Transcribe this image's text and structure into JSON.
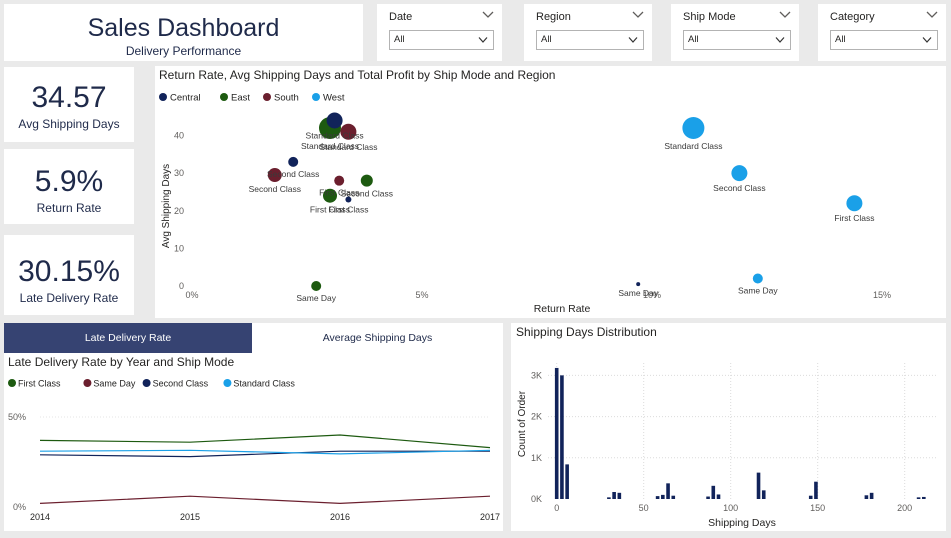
{
  "header": {
    "title": "Sales Dashboard",
    "subtitle": "Delivery Performance"
  },
  "slicers": [
    {
      "label": "Date",
      "value": "All"
    },
    {
      "label": "Region",
      "value": "All"
    },
    {
      "label": "Ship Mode",
      "value": "All"
    },
    {
      "label": "Category",
      "value": "All"
    }
  ],
  "kpis": [
    {
      "value": "34.57",
      "label": "Avg Shipping Days"
    },
    {
      "value": "5.9%",
      "label": "Return Rate"
    },
    {
      "value": "30.15%",
      "label": "Late Delivery Rate"
    }
  ],
  "tabs": {
    "late": "Late Delivery Rate",
    "avg": "Average Shipping Days"
  },
  "colors": {
    "Central": "#11235a",
    "East": "#1d5a10",
    "South": "#6b1f2e",
    "West": "#1aa0e8",
    "accent": "#364372"
  },
  "chart_data": [
    {
      "type": "scatter",
      "title": "Return Rate, Avg Shipping Days and Total Profit by Ship Mode and Region",
      "xlabel": "Return Rate",
      "ylabel": "Avg Shipping Days",
      "xlim": [
        0,
        15.5
      ],
      "ylim": [
        0,
        42
      ],
      "xticks": [
        "0%",
        "5%",
        "10%",
        "15%"
      ],
      "xtick_values": [
        0,
        5,
        10,
        15
      ],
      "yticks": [
        "0",
        "10",
        "20",
        "30",
        "40"
      ],
      "ytick_values": [
        0,
        10,
        20,
        30,
        40
      ],
      "legend_position": "top-left",
      "series": [
        {
          "name": "Central",
          "points": [
            {
              "x": 3.1,
              "y": 44,
              "size": 8,
              "label": "Standard Class"
            },
            {
              "x": 2.2,
              "y": 33,
              "size": 5,
              "label": "Second Class"
            },
            {
              "x": 3.4,
              "y": 23,
              "size": 3,
              "label": "First Class"
            },
            {
              "x": 9.7,
              "y": 0.5,
              "size": 2,
              "label": "Same Day"
            }
          ]
        },
        {
          "name": "East",
          "points": [
            {
              "x": 3.0,
              "y": 42,
              "size": 11,
              "label": "Standard Class"
            },
            {
              "x": 3.0,
              "y": 24,
              "size": 7,
              "label": "First Class"
            },
            {
              "x": 3.8,
              "y": 28,
              "size": 6,
              "label": "Second Class"
            },
            {
              "x": 2.7,
              "y": 0,
              "size": 5,
              "label": "Same Day"
            }
          ]
        },
        {
          "name": "South",
          "points": [
            {
              "x": 3.4,
              "y": 41,
              "size": 8,
              "label": "Standard Class"
            },
            {
              "x": 1.8,
              "y": 29.5,
              "size": 7,
              "label": "Second Class"
            },
            {
              "x": 3.2,
              "y": 28,
              "size": 5,
              "label": "First Class"
            }
          ]
        },
        {
          "name": "West",
          "points": [
            {
              "x": 10.9,
              "y": 42,
              "size": 11,
              "label": "Standard Class"
            },
            {
              "x": 11.9,
              "y": 30,
              "size": 8,
              "label": "Second Class"
            },
            {
              "x": 14.4,
              "y": 22,
              "size": 8,
              "label": "First Class"
            },
            {
              "x": 12.3,
              "y": 2,
              "size": 5,
              "label": "Same Day"
            }
          ]
        }
      ]
    },
    {
      "type": "line",
      "title": "Late Delivery Rate by Year and Ship Mode",
      "categories": [
        "2014",
        "2015",
        "2016",
        "2017"
      ],
      "ylim": [
        0,
        50
      ],
      "yticks": [
        "0%",
        "50%"
      ],
      "ytick_values": [
        0,
        50
      ],
      "legend_position": "top-left",
      "series": [
        {
          "name": "First Class",
          "values": [
            37,
            36,
            40,
            33
          ]
        },
        {
          "name": "Same Day",
          "values": [
            2,
            6,
            2,
            6
          ]
        },
        {
          "name": "Second Class",
          "values": [
            29,
            28,
            31,
            31
          ]
        },
        {
          "name": "Standard Class",
          "values": [
            31,
            31.5,
            29.5,
            31.5
          ]
        }
      ]
    },
    {
      "type": "bar",
      "title": "Shipping Days Distribution",
      "xlabel": "Shipping Days",
      "ylabel": "Count of Order",
      "xlim": [
        -5,
        218
      ],
      "ylim": [
        0,
        3300
      ],
      "xticks": [
        "0",
        "50",
        "100",
        "150",
        "200"
      ],
      "xtick_values": [
        0,
        50,
        100,
        150,
        200
      ],
      "yticks": [
        "0K",
        "1K",
        "2K",
        "3K"
      ],
      "ytick_values": [
        0,
        1000,
        2000,
        3000
      ],
      "x": [
        0,
        3,
        6,
        30,
        33,
        36,
        58,
        61,
        64,
        67,
        87,
        90,
        93,
        116,
        119,
        146,
        149,
        178,
        181,
        208,
        211
      ],
      "values": [
        3180,
        3000,
        840,
        40,
        170,
        150,
        70,
        100,
        380,
        80,
        60,
        320,
        110,
        640,
        210,
        80,
        420,
        90,
        150,
        40,
        50
      ]
    }
  ]
}
